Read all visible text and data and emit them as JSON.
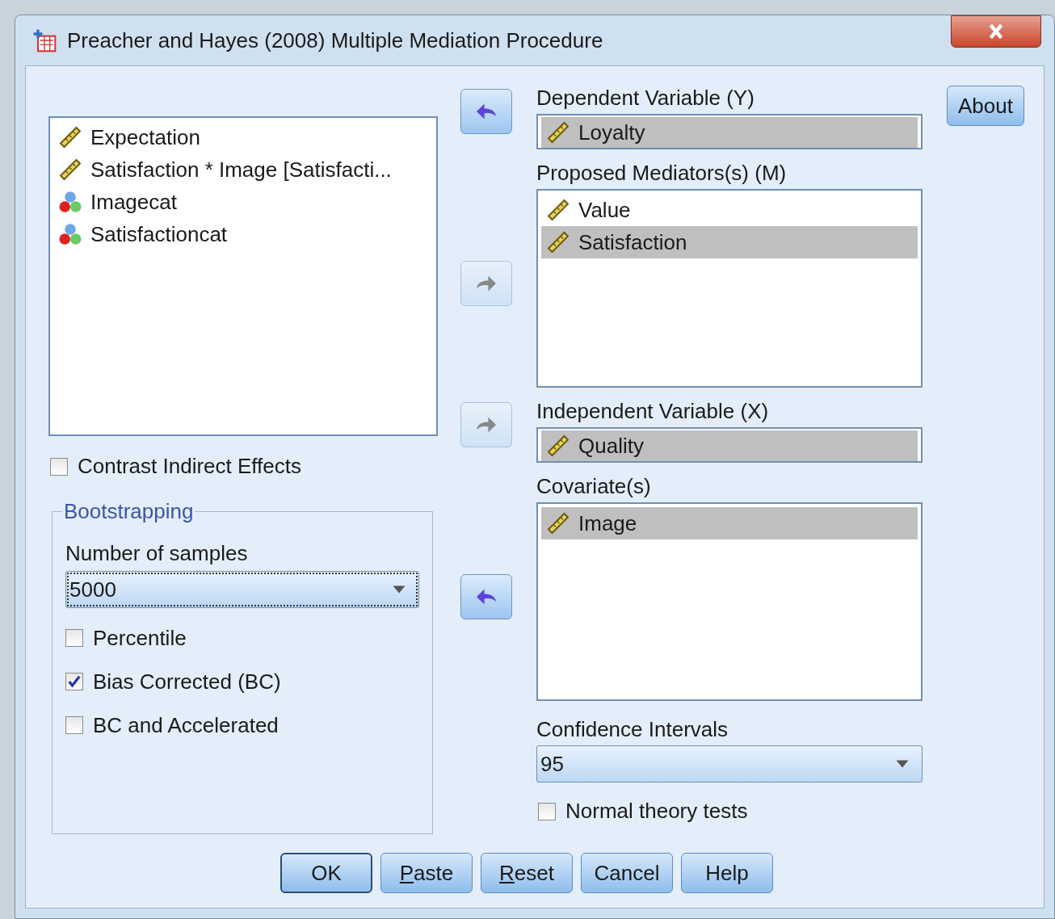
{
  "window": {
    "title": "Preacher and Hayes (2008) Multiple Mediation Procedure"
  },
  "source_list": {
    "items": [
      {
        "label": "Expectation",
        "kind": "scale",
        "selected": false
      },
      {
        "label": "Satisfaction * Image [Satisfacti...",
        "kind": "scale",
        "selected": false
      },
      {
        "label": "Imagecat",
        "kind": "nominal",
        "selected": false
      },
      {
        "label": "Satisfactioncat",
        "kind": "nominal",
        "selected": false
      }
    ]
  },
  "contrast": {
    "label": "Contrast Indirect Effects",
    "checked": false
  },
  "bootstrapping": {
    "legend": "Bootstrapping",
    "samples_label": "Number of samples",
    "samples_value": "5000",
    "options": [
      {
        "label": "Percentile",
        "checked": false
      },
      {
        "label": "Bias Corrected (BC)",
        "checked": true
      },
      {
        "label": "BC and Accelerated",
        "checked": false
      }
    ]
  },
  "targets": [
    {
      "label": "Dependent Variable (Y)",
      "kind": "single",
      "arrow": {
        "kind": "left",
        "disabled": false
      },
      "items": [
        {
          "label": "Loyalty",
          "kind": "scale",
          "selected": true
        }
      ]
    },
    {
      "label": "Proposed Mediators(s) (M)",
      "kind": "multi",
      "arrow": {
        "kind": "right",
        "disabled": true
      },
      "items": [
        {
          "label": "Value",
          "kind": "scale",
          "selected": false
        },
        {
          "label": "Satisfaction",
          "kind": "scale",
          "selected": true
        }
      ]
    },
    {
      "label": "Independent Variable (X)",
      "kind": "single",
      "arrow": {
        "kind": "right",
        "disabled": true
      },
      "items": [
        {
          "label": "Quality",
          "kind": "scale",
          "selected": true
        }
      ]
    },
    {
      "label": "Covariate(s)",
      "kind": "multi",
      "arrow": {
        "kind": "left",
        "disabled": false
      },
      "items": [
        {
          "label": "Image",
          "kind": "scale",
          "selected": true
        }
      ]
    }
  ],
  "confidence": {
    "label": "Confidence Intervals",
    "value": "95"
  },
  "normal_theory": {
    "label": "Normal theory tests",
    "checked": false
  },
  "about_button": "About",
  "buttons": [
    {
      "rest": "OK",
      "default": true
    },
    {
      "mnemonic": "P",
      "rest": "aste",
      "default": false
    },
    {
      "mnemonic": "R",
      "rest": "eset",
      "default": false
    },
    {
      "rest": "Cancel",
      "default": false
    },
    {
      "rest": "Help",
      "default": false
    }
  ]
}
